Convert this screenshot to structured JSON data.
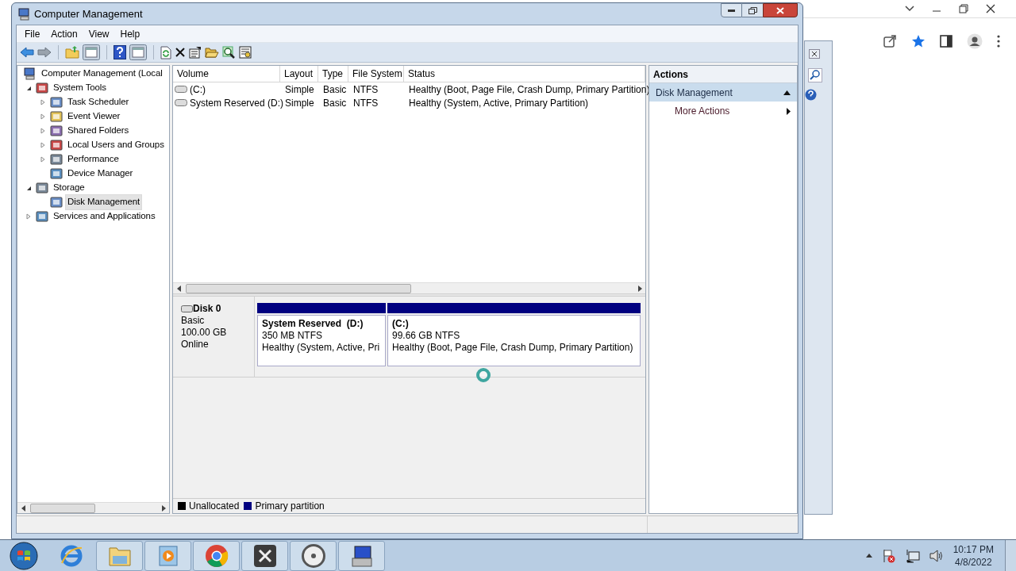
{
  "window": {
    "title": "Computer Management"
  },
  "menu": [
    "File",
    "Action",
    "View",
    "Help"
  ],
  "tree": [
    {
      "label": "Computer Management (Local",
      "selected": false,
      "children": [
        {
          "label": "System Tools",
          "selected": false,
          "expanded": true,
          "children": [
            {
              "label": "Task Scheduler",
              "selected": false,
              "expanded": false
            },
            {
              "label": "Event Viewer",
              "selected": false,
              "expanded": false
            },
            {
              "label": "Shared Folders",
              "selected": false,
              "expanded": false
            },
            {
              "label": "Local Users and Groups",
              "selected": false,
              "expanded": false
            },
            {
              "label": "Performance",
              "selected": false,
              "expanded": false
            },
            {
              "label": "Device Manager",
              "selected": false
            }
          ]
        },
        {
          "label": "Storage",
          "selected": false,
          "expanded": true,
          "children": [
            {
              "label": "Disk Management",
              "selected": true
            }
          ]
        },
        {
          "label": "Services and Applications",
          "selected": false,
          "expanded": false
        }
      ]
    }
  ],
  "volumes": {
    "columns": [
      "Volume",
      "Layout",
      "Type",
      "File System",
      "Status"
    ],
    "rows": [
      [
        "(C:)",
        "Simple",
        "Basic",
        "NTFS",
        "Healthy (Boot, Page File, Crash Dump, Primary Partition)"
      ],
      [
        "System Reserved (D:)",
        "Simple",
        "Basic",
        "NTFS",
        "Healthy (System, Active, Primary Partition)"
      ]
    ]
  },
  "disks": [
    {
      "name": "Disk 0",
      "type": "Basic",
      "size": "100.00 GB",
      "status": "Online",
      "partitions": [
        {
          "name": "System Reserved  (D:)",
          "size": "350 MB NTFS",
          "status": "Healthy (System, Active, Pri",
          "color": "#000080"
        },
        {
          "name": "(C:)",
          "size": "99.66 GB NTFS",
          "status": "Healthy (Boot, Page File, Crash Dump, Primary Partition)",
          "color": "#000080"
        }
      ]
    }
  ],
  "legend": [
    {
      "label": "Unallocated",
      "color": "#000000"
    },
    {
      "label": "Primary partition",
      "color": "#000080"
    }
  ],
  "actions": {
    "title": "Actions",
    "items": [
      {
        "label": "Disk Management",
        "kind": "header"
      },
      {
        "label": "More Actions",
        "kind": "submenu"
      }
    ]
  },
  "clock": {
    "time": "10:17 PM",
    "date": "4/8/2022"
  }
}
